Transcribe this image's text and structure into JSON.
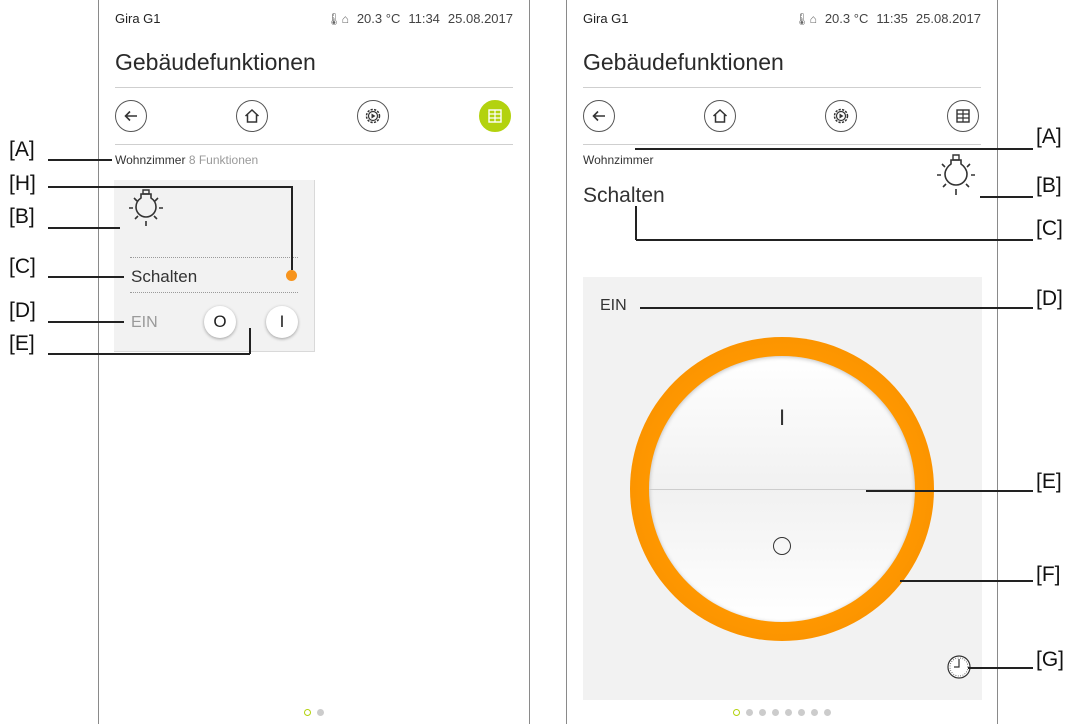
{
  "left_screen": {
    "brand": "Gira G1",
    "temperature": "20.3 °C",
    "time": "11:34",
    "date": "25.08.2017",
    "title": "Gebäudefunktionen",
    "nav": {
      "back_icon": "arrow-left-icon",
      "home_icon": "house-icon",
      "scenes_icon": "play-gear-icon",
      "grid_icon": "grid-icon",
      "active": "grid"
    },
    "room": "Wohnzimmer",
    "function_count": "8",
    "functions_label": "Funktionen",
    "tile": {
      "icon": "bulb-icon",
      "label": "Schalten",
      "state": "EIN",
      "status_color": "#f7941d",
      "off_button": "O",
      "on_button": "I"
    },
    "pager": {
      "pages": 2,
      "active": 0
    }
  },
  "right_screen": {
    "brand": "Gira G1",
    "temperature": "20.3 °C",
    "time": "11:35",
    "date": "25.08.2017",
    "title": "Gebäudefunktionen",
    "nav": {
      "back_icon": "arrow-left-icon",
      "home_icon": "house-icon",
      "scenes_icon": "play-gear-icon",
      "grid_icon": "grid-icon",
      "active": "none"
    },
    "room": "Wohnzimmer",
    "function_title": "Schalten",
    "icon": "bulb-icon",
    "state": "EIN",
    "ring_color": "#ff9800",
    "on_symbol": "I",
    "off_symbol": "O",
    "timer_icon": "clock-icon",
    "pager": {
      "pages": 8,
      "active": 0
    }
  },
  "callouts_left": {
    "a": "[A]",
    "h": "[H]",
    "b": "[B]",
    "c": "[C]",
    "d": "[D]",
    "e": "[E]"
  },
  "callouts_right": {
    "a": "[A]",
    "b": "[B]",
    "c": "[C]",
    "d": "[D]",
    "e": "[E]",
    "f": "[F]",
    "g": "[G]"
  }
}
